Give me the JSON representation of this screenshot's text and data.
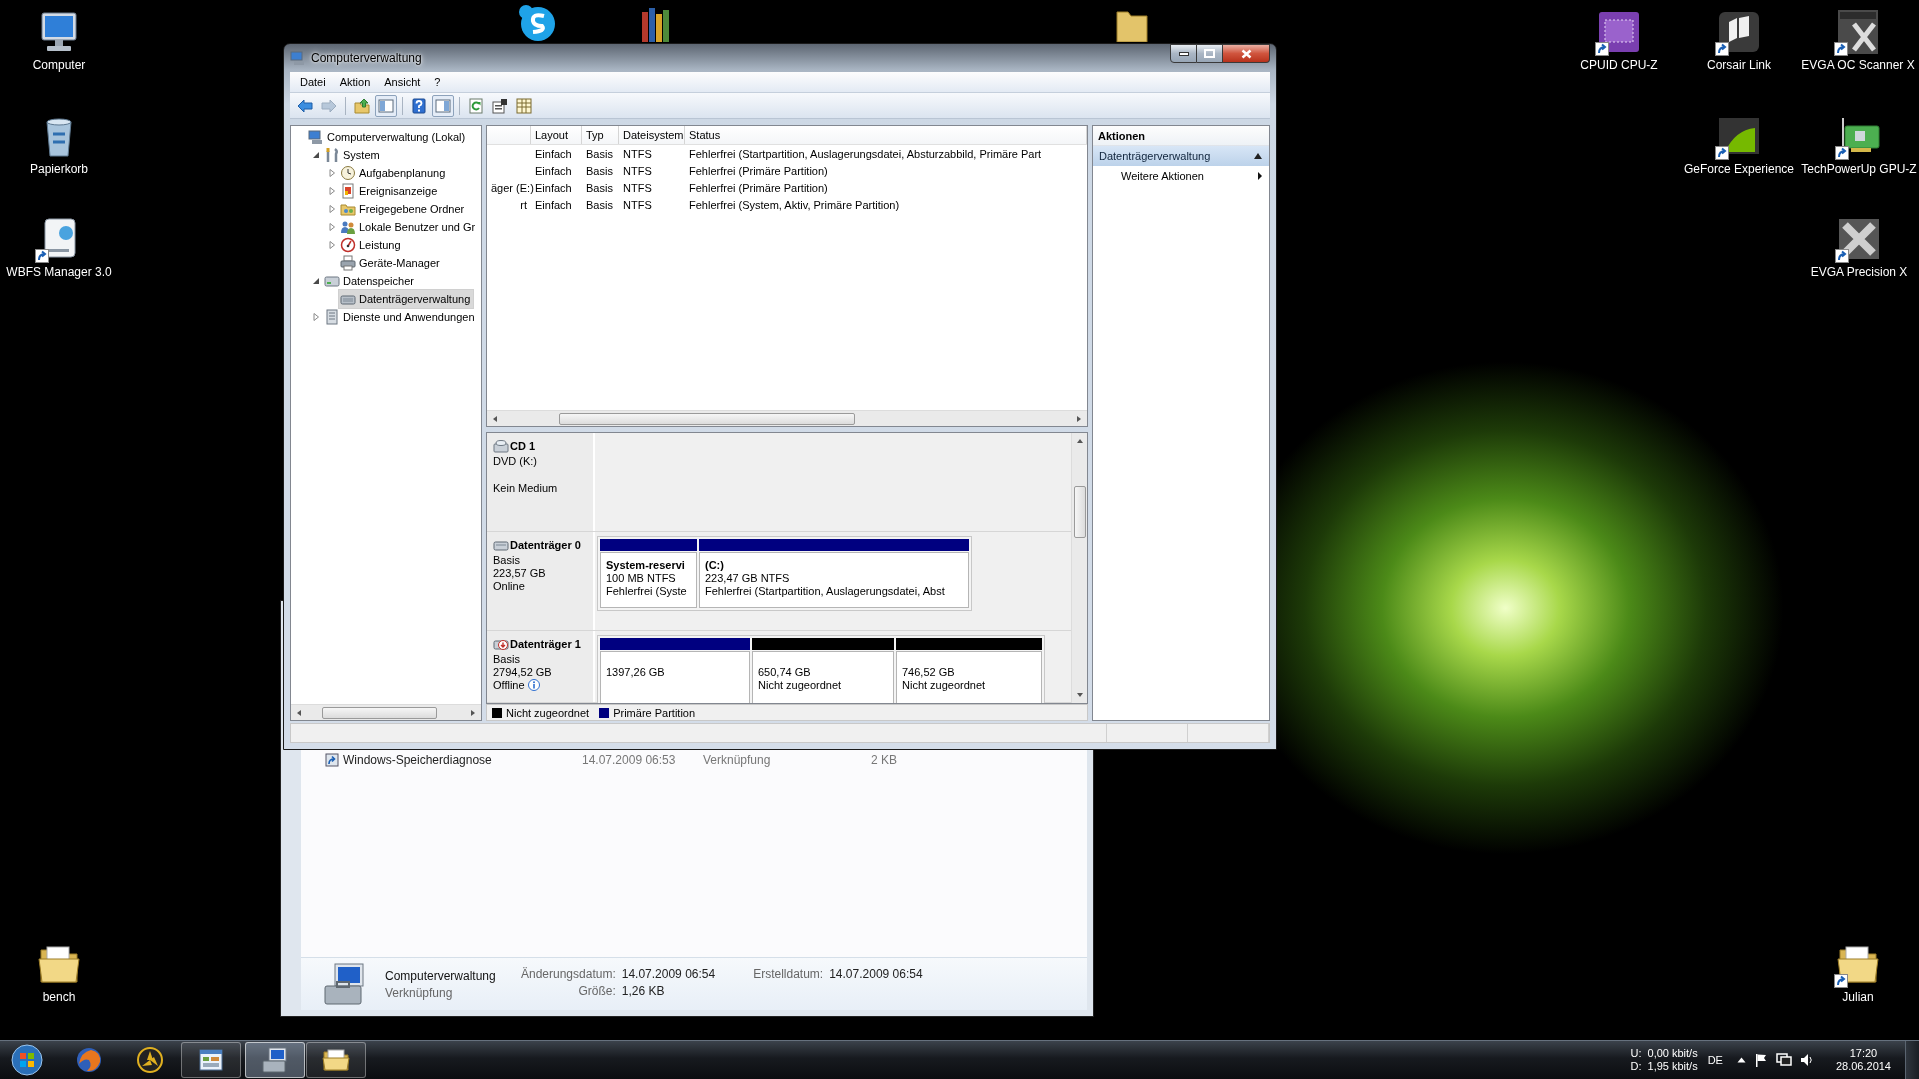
{
  "desktop_icons_left": [
    {
      "label": "Computer",
      "shortcut": false
    },
    {
      "label": "Papierkorb",
      "shortcut": false
    },
    {
      "label": "WBFS Manager 3.0",
      "shortcut": true
    },
    {
      "label": "bench",
      "shortcut": false
    }
  ],
  "desktop_icons_right": [
    {
      "label": "CPUID CPU-Z",
      "shortcut": true
    },
    {
      "label": "Corsair Link",
      "shortcut": true
    },
    {
      "label": "EVGA OC Scanner X",
      "shortcut": true
    },
    {
      "label": "GeForce Experience",
      "shortcut": true
    },
    {
      "label": "TechPowerUp GPU-Z",
      "shortcut": true
    },
    {
      "label": "EVGA Precision X",
      "shortcut": true
    },
    {
      "label": "Julian",
      "shortcut": true
    }
  ],
  "explorer_window": {
    "file_row": {
      "name": "Windows-Speicherdiagnose",
      "date": "14.07.2009 06:53",
      "type": "Verknüpfung",
      "size": "2 KB"
    },
    "details": {
      "name": "Computerverwaltung",
      "type": "Verknüpfung",
      "columns": [
        [
          {
            "label": "Änderungsdatum:",
            "value": "14.07.2009 06:54"
          },
          {
            "label": "Größe:",
            "value": "1,26 KB"
          }
        ],
        [
          {
            "label": "Erstelldatum:",
            "value": "14.07.2009 06:54"
          }
        ]
      ]
    }
  },
  "window": {
    "title": "Computerverwaltung"
  },
  "menu": [
    "Datei",
    "Aktion",
    "Ansicht",
    "?"
  ],
  "toolbar": [
    {
      "disabled": false,
      "pressed": false
    },
    {
      "disabled": true,
      "pressed": false
    },
    {
      "disabled": false,
      "pressed": false
    },
    {
      "disabled": false,
      "pressed": true
    },
    {
      "disabled": false,
      "pressed": false
    },
    {
      "disabled": false,
      "pressed": true
    },
    {
      "disabled": false,
      "pressed": false
    },
    {
      "disabled": false,
      "pressed": false
    },
    {
      "disabled": false,
      "pressed": false
    }
  ],
  "tree": [
    {
      "label": "Computerverwaltung (Lokal)",
      "selected": false,
      "children": [
        {
          "label": "System",
          "expanded": true,
          "selected": false,
          "children": [
            {
              "label": "Aufgabenplanung",
              "expanded": false,
              "selected": false
            },
            {
              "label": "Ereignisanzeige",
              "expanded": false,
              "selected": false
            },
            {
              "label": "Freigegebene Ordner",
              "expanded": false,
              "selected": false
            },
            {
              "label": "Lokale Benutzer und Gr",
              "expanded": false,
              "selected": false
            },
            {
              "label": "Leistung",
              "expanded": false,
              "selected": false
            },
            {
              "label": "Geräte-Manager",
              "selected": false
            }
          ]
        },
        {
          "label": "Datenspeicher",
          "expanded": true,
          "selected": false,
          "children": [
            {
              "label": "Datenträgerverwaltung",
              "selected": true
            }
          ]
        },
        {
          "label": "Dienste und Anwendungen",
          "expanded": false,
          "selected": false
        }
      ]
    }
  ],
  "volume_list": {
    "columns": [
      "Layout",
      "Typ",
      "Dateisystem",
      "Status"
    ],
    "rows": [
      {
        "layout": "Einfach",
        "type": "Basis",
        "file_system": "NTFS",
        "status": "Fehlerfrei (Startpartition, Auslagerungsdatei, Absturzabbild, Primäre Part"
      },
      {
        "layout": "Einfach",
        "type": "Basis",
        "file_system": "NTFS",
        "status": "Fehlerfrei (Primäre Partition)"
      },
      {
        "column_1": "äger (E:)",
        "layout": "Einfach",
        "type": "Basis",
        "file_system": "NTFS",
        "status": "Fehlerfrei (Primäre Partition)"
      },
      {
        "column_1": "rt",
        "layout": "Einfach",
        "type": "Basis",
        "file_system": "NTFS",
        "status": "Fehlerfrei (System, Aktiv, Primäre Partition)"
      }
    ]
  },
  "disks": [
    {
      "kind": "cdrom",
      "name": "CD 1",
      "lines": [
        "DVD (K:)"
      ],
      "note": "Kein Medium"
    },
    {
      "kind": "disk",
      "name": "Datenträger 0",
      "lines": [
        "Basis",
        "223,57 GB",
        "Online"
      ],
      "offline": false,
      "partitions": [
        {
          "color": "#000080",
          "title": "System-reservi",
          "lines": [
            "100 MB NTFS",
            "Fehlerfrei (Syste"
          ]
        },
        {
          "color": "#000080",
          "title": "(C:)",
          "lines": [
            "223,47 GB NTFS",
            "Fehlerfrei (Startpartition, Auslagerungsdatei, Abst"
          ]
        }
      ]
    },
    {
      "kind": "disk",
      "name": "Datenträger 1",
      "lines": [
        "Basis",
        "2794,52 GB",
        "Offline"
      ],
      "offline": true,
      "partitions": [
        {
          "color": "#000080",
          "lines": [
            "1397,26 GB"
          ]
        },
        {
          "color": "#000000",
          "lines": [
            "650,74 GB",
            "Nicht zugeordnet"
          ]
        },
        {
          "color": "#000000",
          "lines": [
            "746,52 GB",
            "Nicht zugeordnet"
          ]
        }
      ]
    }
  ],
  "legend": [
    {
      "color": "#000000",
      "label": "Nicht zugeordnet"
    },
    {
      "color": "#000080",
      "label": "Primäre Partition"
    }
  ],
  "actions": {
    "header": "Aktionen",
    "section": "Datenträgerverwaltung",
    "section_expanded": true,
    "items": [
      "Weitere Aktionen"
    ]
  },
  "taskbar": {
    "items": [
      {
        "running": false,
        "selected": false
      },
      {
        "running": false,
        "selected": false
      },
      {
        "running": true,
        "selected": false
      },
      {
        "running": true,
        "selected": true
      },
      {
        "running": true,
        "selected": false
      }
    ],
    "tray": {
      "meter_labels": [
        "U:",
        "D:"
      ],
      "meter_values": [
        "0,00 kbit/s",
        "1,95 kbit/s"
      ],
      "language": "DE",
      "time": "17:20",
      "date": "28.06.2014"
    }
  }
}
